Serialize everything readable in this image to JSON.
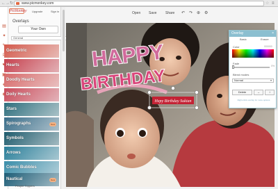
{
  "browser": {
    "back": "←",
    "forward": "→",
    "reload": "↻",
    "url": "www.picmonkey.com",
    "star": "☆",
    "menu": "≡"
  },
  "header": {
    "logo": "PicMonkey",
    "upgrade": "Upgrade",
    "signin": "Sign in"
  },
  "overlays_panel": {
    "title": "Overlays",
    "your_own_button": "Your Own",
    "category_select": "General",
    "items": [
      {
        "label": "Geometric",
        "color": "#d45a4c",
        "badge": ""
      },
      {
        "label": "Hearts",
        "color": "#c7424f",
        "badge": ""
      },
      {
        "label": "Doodly Hearts",
        "color": "#d86a6a",
        "badge": ""
      },
      {
        "label": "Doily Hearts",
        "color": "#c94b5a",
        "badge": ""
      },
      {
        "label": "Stars",
        "color": "#2f6f7e",
        "badge": ""
      },
      {
        "label": "Spirographs",
        "color": "#3a6e8a",
        "badge": "New"
      },
      {
        "label": "Symbols",
        "color": "#1f5c6e",
        "badge": ""
      },
      {
        "label": "Arrows",
        "color": "#2a7f9a",
        "badge": ""
      },
      {
        "label": "Comic Bubbles",
        "color": "#3b8eaa",
        "badge": ""
      },
      {
        "label": "Nautical",
        "color": "#1d5d77",
        "badge": "New"
      }
    ],
    "bottom_label": "People Toppers"
  },
  "toolbar": {
    "open": "Open",
    "save": "Save",
    "share": "Share",
    "undo_icon": "↶",
    "redo_icon": "↷",
    "zoom_icon": "⊕",
    "settings_icon": "⚙"
  },
  "canvas": {
    "happy_text": "HAPPY",
    "birthday_text": "BIRTHDAY",
    "banner_text": "Hepy Birthday Sukian"
  },
  "overlay_window": {
    "title": "Overlay",
    "close": "×",
    "tab_basic": "Basic",
    "tab_eraser": "Eraser",
    "color_label": "Color",
    "color_value": "000000",
    "fade_label": "Fade",
    "fade_value": "0%",
    "fade_level": 0,
    "blend_label": "Blend modes",
    "blend_value": "Normal",
    "delete_button": "Delete",
    "flip_h_icon": "↔",
    "flip_v_icon": "↕",
    "hint": "Right-click overlay for more options"
  }
}
